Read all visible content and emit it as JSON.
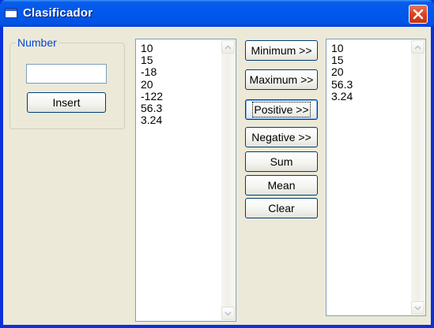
{
  "window": {
    "title": "Clasificador"
  },
  "group": {
    "label": "Number"
  },
  "input": {
    "value": ""
  },
  "buttons": {
    "insert": "Insert",
    "minimum": "Minimum >>",
    "maximum": "Maximum >>",
    "positive": "Positive >>",
    "negative": "Negative >>",
    "sum": "Sum",
    "mean": "Mean",
    "clear": "Clear"
  },
  "numbers_list": [
    "10",
    "15",
    "-18",
    "20",
    "-122",
    "56.3",
    "3.24"
  ],
  "result_list": [
    "10",
    "15",
    "20",
    "56.3",
    "3.24"
  ],
  "icons": {
    "app": "window-icon",
    "close": "close-icon",
    "scroll_up": "chevron-up-icon",
    "scroll_down": "chevron-down-icon"
  },
  "colors": {
    "titlebar": "#0054e3",
    "client_bg": "#ece9d8",
    "group_label": "#0046d5",
    "close_button": "#d9441f"
  }
}
